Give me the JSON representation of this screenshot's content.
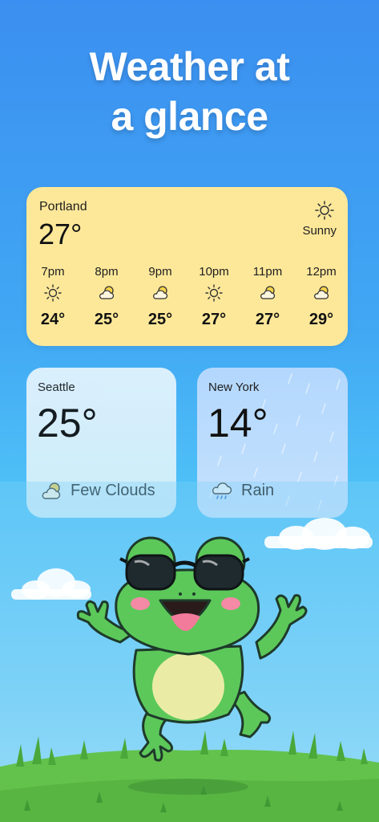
{
  "headline": {
    "line1": "Weather at",
    "line2": "a glance"
  },
  "portland": {
    "city": "Portland",
    "temp": "27°",
    "condition": "Sunny",
    "icon": "sun-icon",
    "hourly": [
      {
        "time": "7pm",
        "icon": "sun-icon",
        "temp": "24°"
      },
      {
        "time": "8pm",
        "icon": "partly-cloudy-icon",
        "temp": "25°"
      },
      {
        "time": "9pm",
        "icon": "partly-cloudy-icon",
        "temp": "25°"
      },
      {
        "time": "10pm",
        "icon": "sun-icon",
        "temp": "27°"
      },
      {
        "time": "11pm",
        "icon": "partly-cloudy-icon",
        "temp": "27°"
      },
      {
        "time": "12pm",
        "icon": "partly-cloudy-icon",
        "temp": "29°"
      }
    ]
  },
  "seattle": {
    "city": "Seattle",
    "temp": "25°",
    "condition": "Few Clouds",
    "icon": "few-clouds-icon"
  },
  "newyork": {
    "city": "New York",
    "temp": "14°",
    "condition": "Rain",
    "icon": "rain-cloud-icon"
  },
  "colors": {
    "portland_card": "#fde89a",
    "seattle_card": "#dff2fc",
    "newyork_card": "#bcdcfd",
    "sky_top": "#3b8ff0",
    "frog_green": "#5cc85a",
    "grass": "#5fbf4a"
  }
}
